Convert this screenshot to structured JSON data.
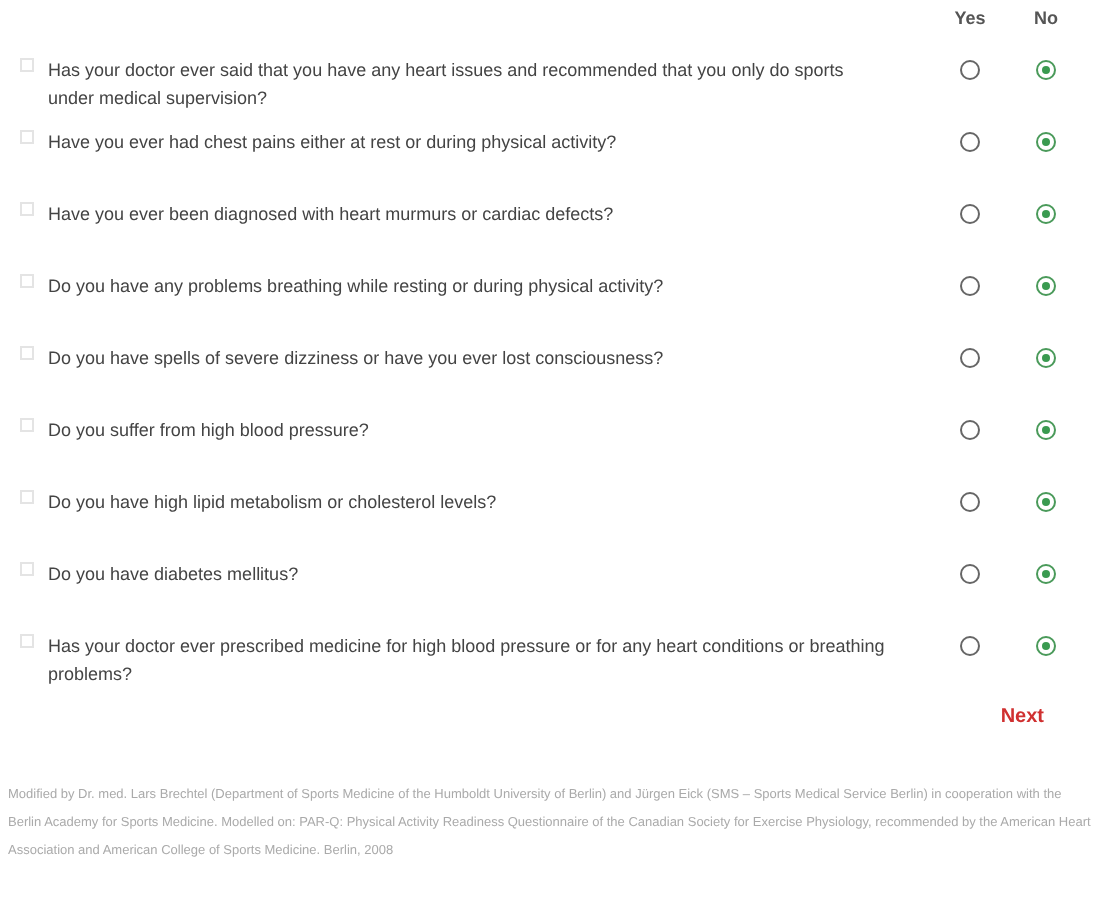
{
  "columns": [
    "Yes",
    "No"
  ],
  "questions": [
    {
      "text": "Has your doctor ever said that you have any heart issues and recommended that you only do sports under medical supervision?",
      "yes_selected": false,
      "no_selected": true
    },
    {
      "text": "Have you ever had chest pains either at rest or during physical activity?",
      "yes_selected": false,
      "no_selected": true
    },
    {
      "text": "Have you ever been diagnosed with heart murmurs or cardiac defects?",
      "yes_selected": false,
      "no_selected": true
    },
    {
      "text": "Do you have any problems breathing while resting or during physical activity?",
      "yes_selected": false,
      "no_selected": true
    },
    {
      "text": "Do you have spells of severe dizziness or have you ever lost consciousness?",
      "yes_selected": false,
      "no_selected": true
    },
    {
      "text": "Do you suffer from high blood pressure?",
      "yes_selected": false,
      "no_selected": true
    },
    {
      "text": "Do you have high lipid metabolism or cholesterol levels?",
      "yes_selected": false,
      "no_selected": true
    },
    {
      "text": "Do you have diabetes mellitus?",
      "yes_selected": false,
      "no_selected": true
    },
    {
      "text": "Has your doctor ever prescribed medicine for high blood pressure or for any heart conditions or breathing problems?",
      "yes_selected": false,
      "no_selected": true
    }
  ],
  "next_button": "Next",
  "footer": "Modified by Dr. med. Lars Brechtel (Department of Sports Medicine of the Humboldt University of Berlin) and Jürgen Eick (SMS – Sports Medical Service Berlin) in cooperation with the Berlin Academy for Sports Medicine. Modelled on: PAR-Q: Physical Activity Readiness Questionnaire of the Canadian Society for Exercise Physiology, recommended by the American Heart Association and American College of Sports Medicine. Berlin, 2008"
}
